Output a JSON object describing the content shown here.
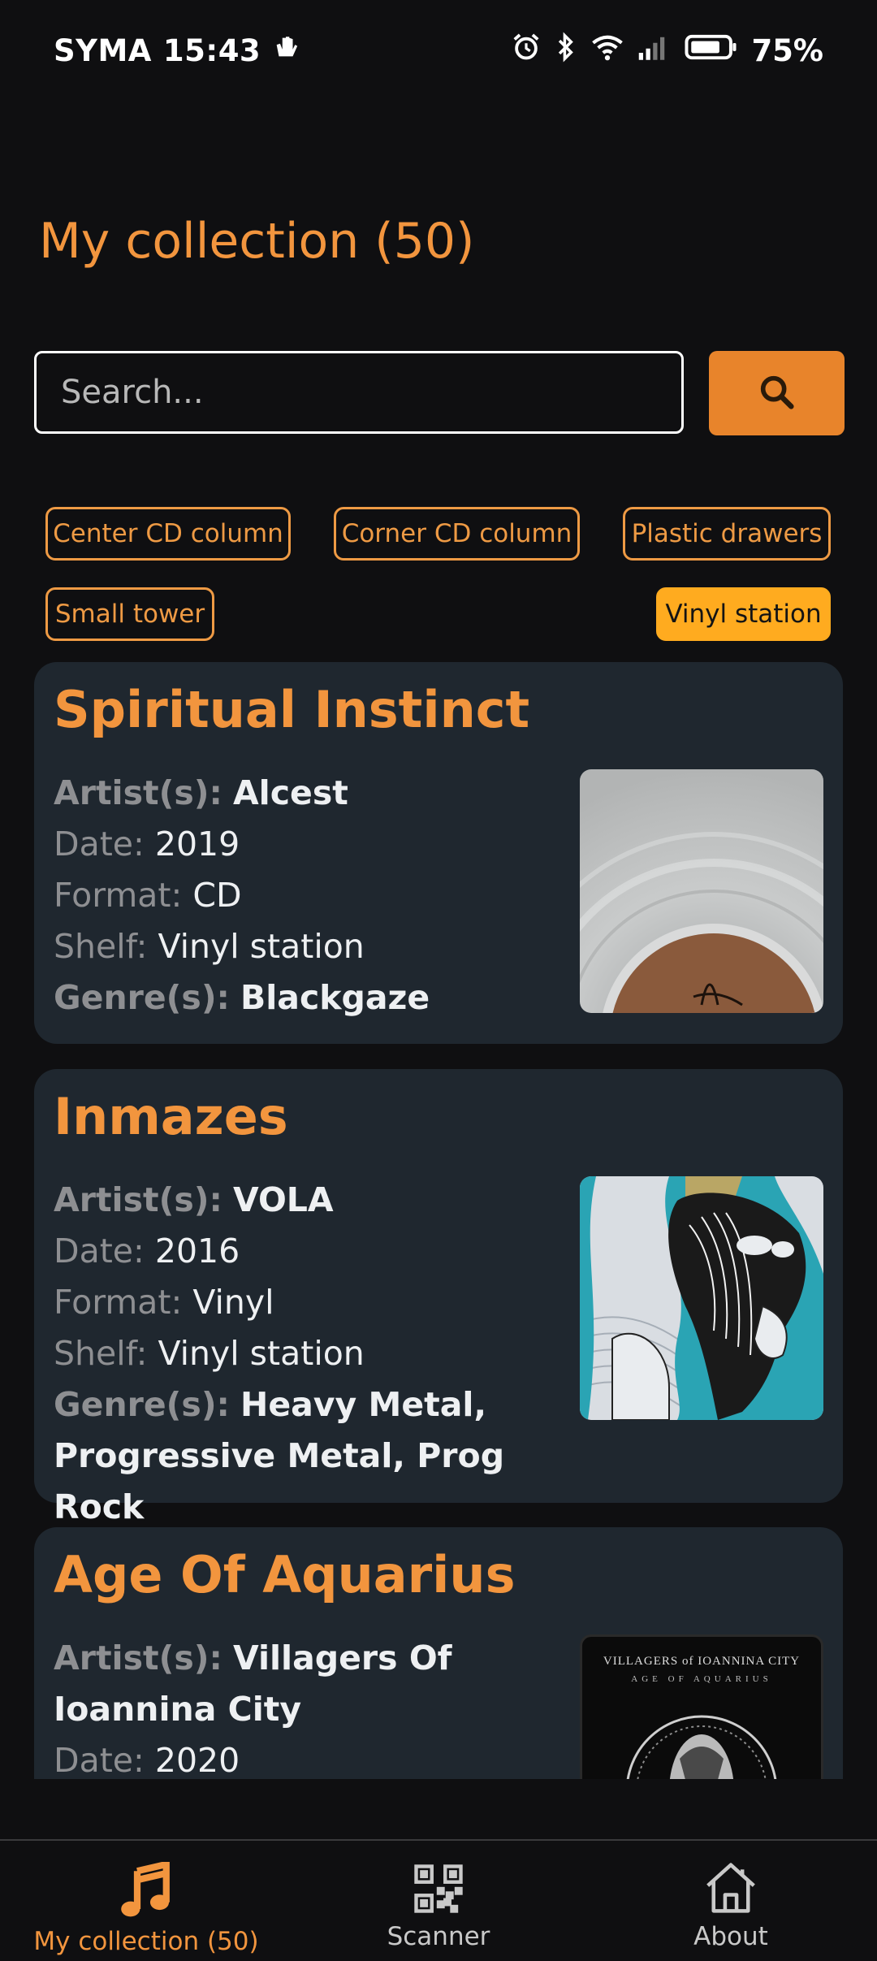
{
  "status_bar": {
    "carrier": "SYMA",
    "time": "15:43",
    "battery": "75%"
  },
  "header": {
    "title": "My collection (50)"
  },
  "search": {
    "placeholder": "Search..."
  },
  "shelves": [
    {
      "label": "Center CD column",
      "active": false
    },
    {
      "label": "Corner CD column",
      "active": false
    },
    {
      "label": "Plastic drawers",
      "active": false
    },
    {
      "label": "Small tower",
      "active": false
    },
    {
      "label": "Vinyl station",
      "active": true
    }
  ],
  "field_labels": {
    "artist": "Artist(s):",
    "date": "Date:",
    "format": "Format:",
    "shelf": "Shelf:",
    "genre": "Genre(s):"
  },
  "albums": [
    {
      "title": "Spiritual Instinct",
      "artist": "Alcest",
      "date": "2019",
      "format": "CD",
      "shelf": "Vinyl station",
      "genre": "Blackgaze"
    },
    {
      "title": "Inmazes",
      "artist": "VOLA",
      "date": "2016",
      "format": "Vinyl",
      "shelf": "Vinyl station",
      "genre": "Heavy Metal, Progressive Metal, Prog Rock"
    },
    {
      "title": "Age Of Aquarius",
      "artist": "Villagers Of Ioannina City",
      "date": "2020",
      "cover_text_1": "VILLAGERS of IOANNINA CITY",
      "cover_text_2": "AGE OF AQUARIUS"
    }
  ],
  "bottom_nav": [
    {
      "label": "My collection (50)",
      "icon": "music-note-icon",
      "active": true
    },
    {
      "label": "Scanner",
      "icon": "qr-code-icon",
      "active": false
    },
    {
      "label": "About",
      "icon": "home-icon",
      "active": false
    }
  ],
  "colors": {
    "accent": "#f2953e",
    "active_chip": "#ffab1f",
    "card_bg": "#1f272f",
    "background": "#0f0f11"
  }
}
